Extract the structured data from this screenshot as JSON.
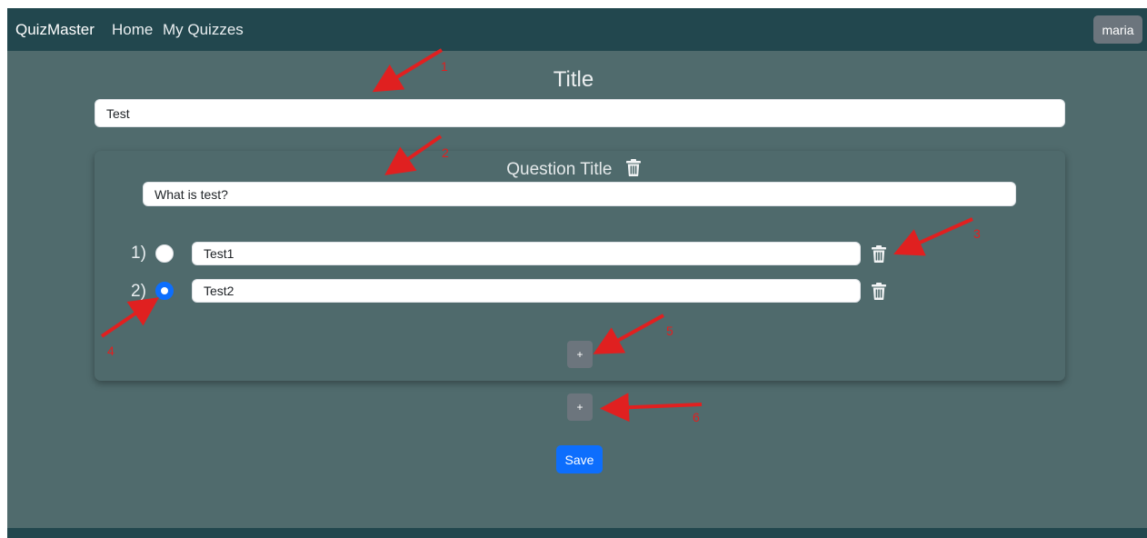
{
  "nav": {
    "brand": "QuizMaster",
    "links": [
      "Home",
      "My Quizzes"
    ],
    "user": "maria"
  },
  "quiz": {
    "title_heading": "Title",
    "title_value": "Test",
    "question_heading": "Question Title",
    "question_value": "What is test?",
    "options": [
      {
        "number": "1)",
        "value": "Test1",
        "selected": false
      },
      {
        "number": "2)",
        "value": "Test2",
        "selected": true
      }
    ],
    "add_option_label": "+",
    "add_question_label": "+",
    "save_label": "Save"
  },
  "annotations": [
    "1",
    "2",
    "3",
    "4",
    "5",
    "6"
  ],
  "colors": {
    "navbar": "#22474e",
    "background": "#506b6d",
    "accent": "#0d6efd",
    "secondary_button": "#6c757d",
    "annotation": "#e02020"
  },
  "icons": [
    "trash-icon"
  ]
}
